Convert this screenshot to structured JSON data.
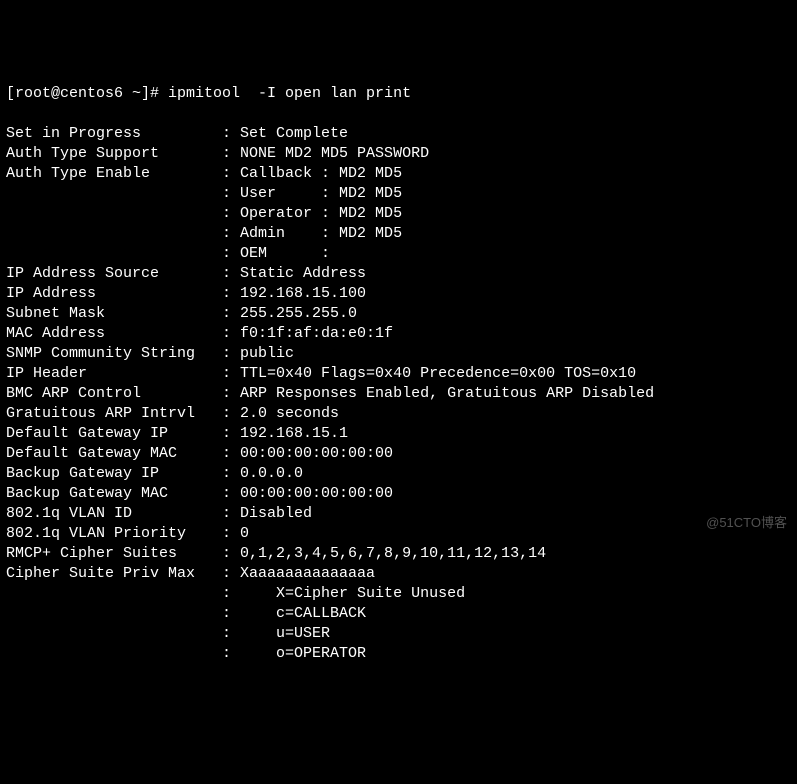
{
  "prompt": "[root@centos6 ~]# ipmitool  -I open lan print",
  "rows": [
    {
      "label": "Set in Progress",
      "value": "Set Complete"
    },
    {
      "label": "Auth Type Support",
      "value": "NONE MD2 MD5 PASSWORD"
    },
    {
      "label": "Auth Type Enable",
      "value": "Callback : MD2 MD5"
    },
    {
      "label": "",
      "value": "User     : MD2 MD5"
    },
    {
      "label": "",
      "value": "Operator : MD2 MD5"
    },
    {
      "label": "",
      "value": "Admin    : MD2 MD5"
    },
    {
      "label": "",
      "value": "OEM      :"
    },
    {
      "label": "IP Address Source",
      "value": "Static Address"
    },
    {
      "label": "IP Address",
      "value": "192.168.15.100"
    },
    {
      "label": "Subnet Mask",
      "value": "255.255.255.0"
    },
    {
      "label": "MAC Address",
      "value": "f0:1f:af:da:e0:1f"
    },
    {
      "label": "SNMP Community String",
      "value": "public"
    },
    {
      "label": "IP Header",
      "value": "TTL=0x40 Flags=0x40 Precedence=0x00 TOS=0x10"
    },
    {
      "label": "BMC ARP Control",
      "value": "ARP Responses Enabled, Gratuitous ARP Disabled"
    },
    {
      "label": "Gratuitous ARP Intrvl",
      "value": "2.0 seconds"
    },
    {
      "label": "Default Gateway IP",
      "value": "192.168.15.1"
    },
    {
      "label": "Default Gateway MAC",
      "value": "00:00:00:00:00:00"
    },
    {
      "label": "Backup Gateway IP",
      "value": "0.0.0.0"
    },
    {
      "label": "Backup Gateway MAC",
      "value": "00:00:00:00:00:00"
    },
    {
      "label": "802.1q VLAN ID",
      "value": "Disabled"
    },
    {
      "label": "802.1q VLAN Priority",
      "value": "0"
    },
    {
      "label": "RMCP+ Cipher Suites",
      "value": "0,1,2,3,4,5,6,7,8,9,10,11,12,13,14"
    },
    {
      "label": "Cipher Suite Priv Max",
      "value": "Xaaaaaaaaaaaaaa"
    },
    {
      "label": "",
      "value": "    X=Cipher Suite Unused"
    },
    {
      "label": "",
      "value": "    c=CALLBACK"
    },
    {
      "label": "",
      "value": "    u=USER"
    },
    {
      "label": "",
      "value": "    o=OPERATOR"
    }
  ],
  "label_width": 24,
  "watermark": "@51CTO博客"
}
